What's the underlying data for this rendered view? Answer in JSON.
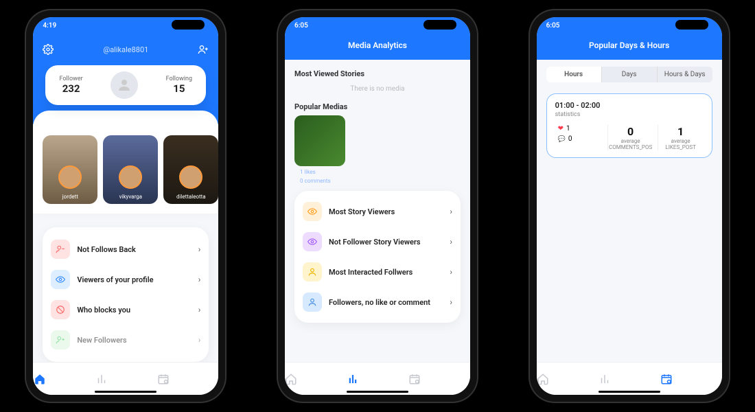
{
  "screen1": {
    "time": "4:19",
    "username": "@alikale8801",
    "stats": {
      "follower_label": "Follower",
      "follower_value": "232",
      "following_label": "Following",
      "following_value": "15"
    },
    "stories": [
      {
        "name": "jordett"
      },
      {
        "name": "vikyvarga"
      },
      {
        "name": "dilettaleotta"
      }
    ],
    "menu": [
      {
        "label": "Not Follows Back"
      },
      {
        "label": "Viewers of your profile"
      },
      {
        "label": "Who blocks you"
      },
      {
        "label": "New Followers"
      }
    ]
  },
  "screen2": {
    "time": "6:05",
    "title": "Media Analytics",
    "section_mvs": "Most Viewed Stories",
    "empty_text": "There is no media",
    "section_pop": "Popular Medias",
    "thumb_likes": "1 likes",
    "thumb_comments": "0 comments",
    "menu": [
      {
        "label": "Most Story Viewers"
      },
      {
        "label": "Not Follower Story Viewers"
      },
      {
        "label": "Most Interacted Follwers"
      },
      {
        "label": "Followers, no like or comment"
      }
    ]
  },
  "screen3": {
    "time": "6:05",
    "title": "Popular Days & Hours",
    "tabs": {
      "hours": "Hours",
      "days": "Days",
      "both": "Hours & Days"
    },
    "card": {
      "range": "01:00 - 02:00",
      "sub": "statistics",
      "heart_count": "1",
      "bubble_count": "0",
      "comments_value": "0",
      "comments_avg": "average",
      "comments_label": "COMMENTS_POS",
      "likes_value": "1",
      "likes_avg": "average",
      "likes_label": "LIKES_POST"
    }
  }
}
